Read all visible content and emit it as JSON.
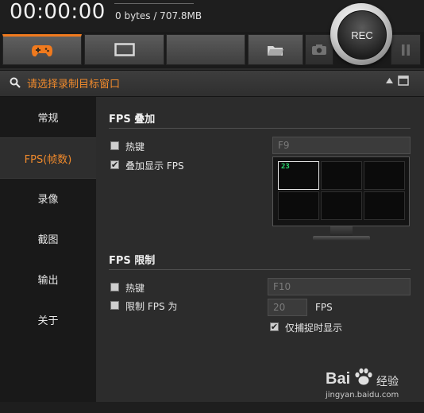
{
  "header": {
    "timer": "00:00:00",
    "size_text": "0 bytes / 707.8MB",
    "rec_label": "REC"
  },
  "toolbar": {
    "tabs": [
      {
        "icon": "gamepad-icon",
        "active": true
      },
      {
        "icon": "monitor-icon",
        "active": false
      },
      {
        "icon": "blank",
        "active": false
      },
      {
        "icon": "folder-icon",
        "active": false
      },
      {
        "icon": "camera-icon",
        "active": false
      },
      {
        "icon": "pause-icon",
        "active": false
      }
    ]
  },
  "window_bar": {
    "text": "请选择录制目标窗口",
    "icons": [
      "search-icon",
      "caret-up-icon",
      "window-icon"
    ]
  },
  "sidebar": {
    "items": [
      {
        "label": "常规",
        "active": false
      },
      {
        "label": "FPS(帧数)",
        "active": true
      },
      {
        "label": "录像",
        "active": false
      },
      {
        "label": "截图",
        "active": false
      },
      {
        "label": "输出",
        "active": false
      },
      {
        "label": "关于",
        "active": false
      }
    ]
  },
  "fps_overlay": {
    "title": "FPS 叠加",
    "hotkey_label": "热键",
    "hotkey_checked": false,
    "hotkey_value": "F9",
    "show_overlay_label": "叠加显示 FPS",
    "show_overlay_checked": true,
    "preview_fps": "23"
  },
  "fps_limit": {
    "title": "FPS 限制",
    "hotkey_label": "热键",
    "hotkey_checked": false,
    "hotkey_value": "F10",
    "limit_label": "限制 FPS 为",
    "limit_checked": false,
    "limit_value": "20",
    "fps_unit": "FPS",
    "capture_only_label": "仅捕捉时显示",
    "capture_only_checked": true
  },
  "watermark": {
    "brand": "Bai",
    "brand2": "经验",
    "url": "jingyan.baidu.com"
  },
  "colors": {
    "accent": "#f08a2c",
    "fps_green": "#28d36b"
  }
}
